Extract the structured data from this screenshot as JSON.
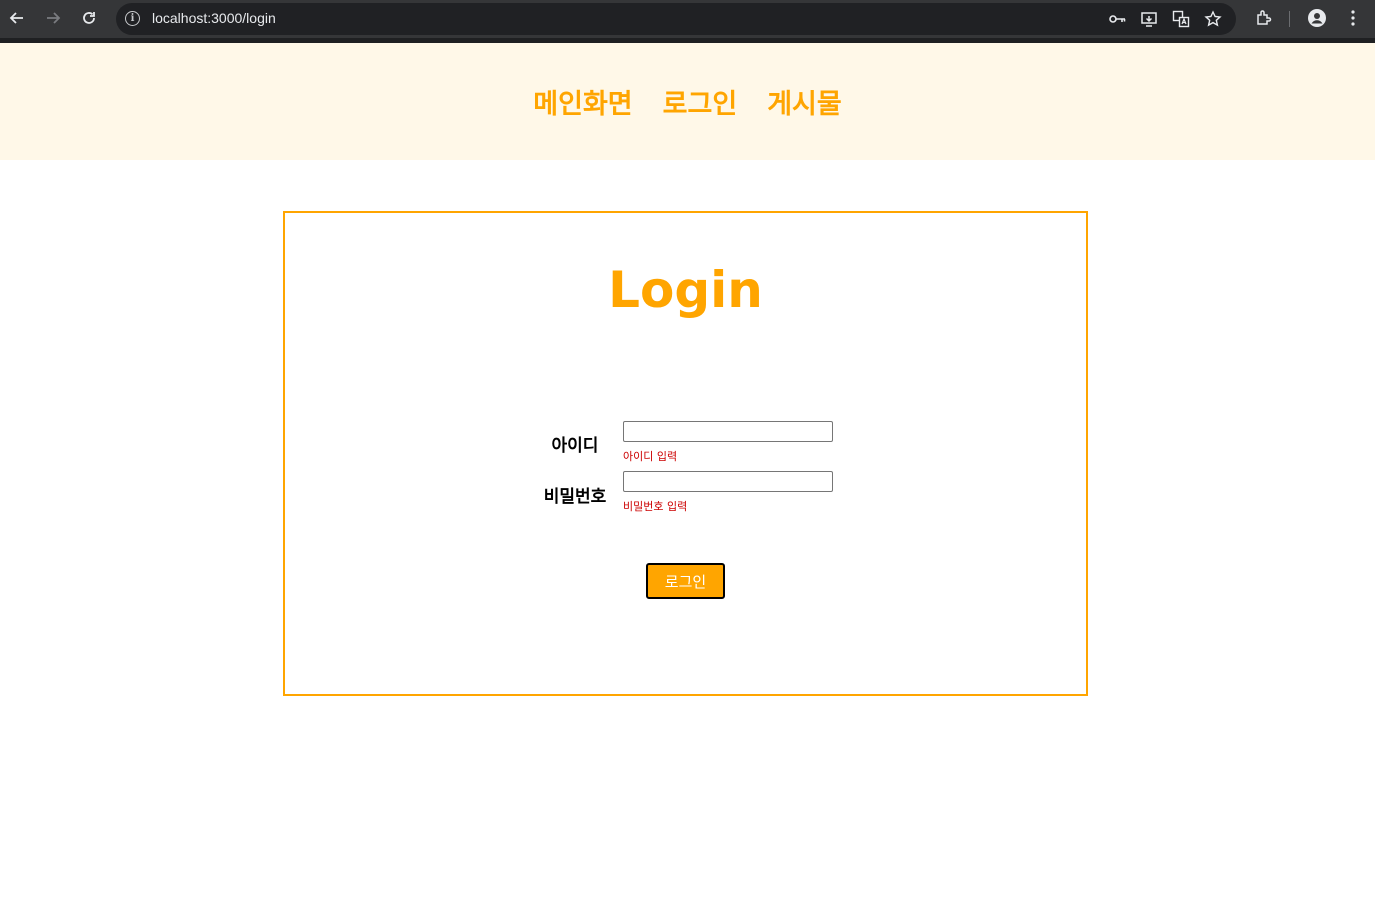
{
  "browser": {
    "url": "localhost:3000/login",
    "back_icon": "arrow-left-icon",
    "forward_icon": "arrow-right-icon",
    "reload_icon": "reload-icon"
  },
  "nav": {
    "items": [
      {
        "label": "메인화면"
      },
      {
        "label": "로그인"
      },
      {
        "label": "게시물"
      }
    ]
  },
  "login": {
    "title": "Login",
    "id_label": "아이디",
    "id_value": "",
    "id_hint": "아이디 입력",
    "password_label": "비밀번호",
    "password_value": "",
    "password_hint": "비밀번호 입력",
    "submit_label": "로그인"
  },
  "colors": {
    "accent": "#ffa500",
    "header_bg": "#fff8e8",
    "hint": "#cc0000"
  }
}
